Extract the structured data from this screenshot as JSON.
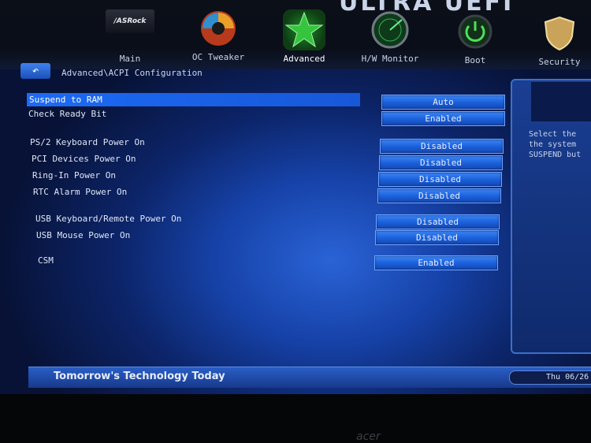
{
  "header": {
    "title_fragment": "ULTRA UEFI",
    "tabs": [
      {
        "label": "Main",
        "icon": "asrock-logo-icon"
      },
      {
        "label": "OC Tweaker",
        "icon": "swirl-icon"
      },
      {
        "label": "Advanced",
        "icon": "star-icon"
      },
      {
        "label": "H/W Monitor",
        "icon": "radar-icon"
      },
      {
        "label": "Boot",
        "icon": "power-icon"
      },
      {
        "label": "Security",
        "icon": "shield-icon"
      }
    ],
    "logo_text": "/ASRock"
  },
  "breadcrumb": "Advanced\\ACPI Configuration",
  "settings": [
    {
      "label": "Suspend to RAM",
      "value": "Auto"
    },
    {
      "label": "Check Ready Bit",
      "value": "Enabled"
    },
    {
      "label": "PS/2 Keyboard Power On",
      "value": "Disabled"
    },
    {
      "label": "PCI Devices Power On",
      "value": "Disabled"
    },
    {
      "label": "Ring-In Power On",
      "value": "Disabled"
    },
    {
      "label": "RTC Alarm Power On",
      "value": "Disabled"
    },
    {
      "label": "USB Keyboard/Remote Power On",
      "value": "Disabled"
    },
    {
      "label": "USB Mouse Power On",
      "value": "Disabled"
    },
    {
      "label": "CSM",
      "value": "Enabled"
    }
  ],
  "help": {
    "text": "Select the\nthe system\nSUSPEND but"
  },
  "footer": {
    "slogan": "Tomorrow's Technology Today",
    "clock": "Thu 06/26"
  },
  "monitor": {
    "brand": "acer"
  },
  "colors": {
    "accent": "#1c6af5",
    "selected_row": "#1758d8",
    "active_tab": "#1e8f2a"
  }
}
